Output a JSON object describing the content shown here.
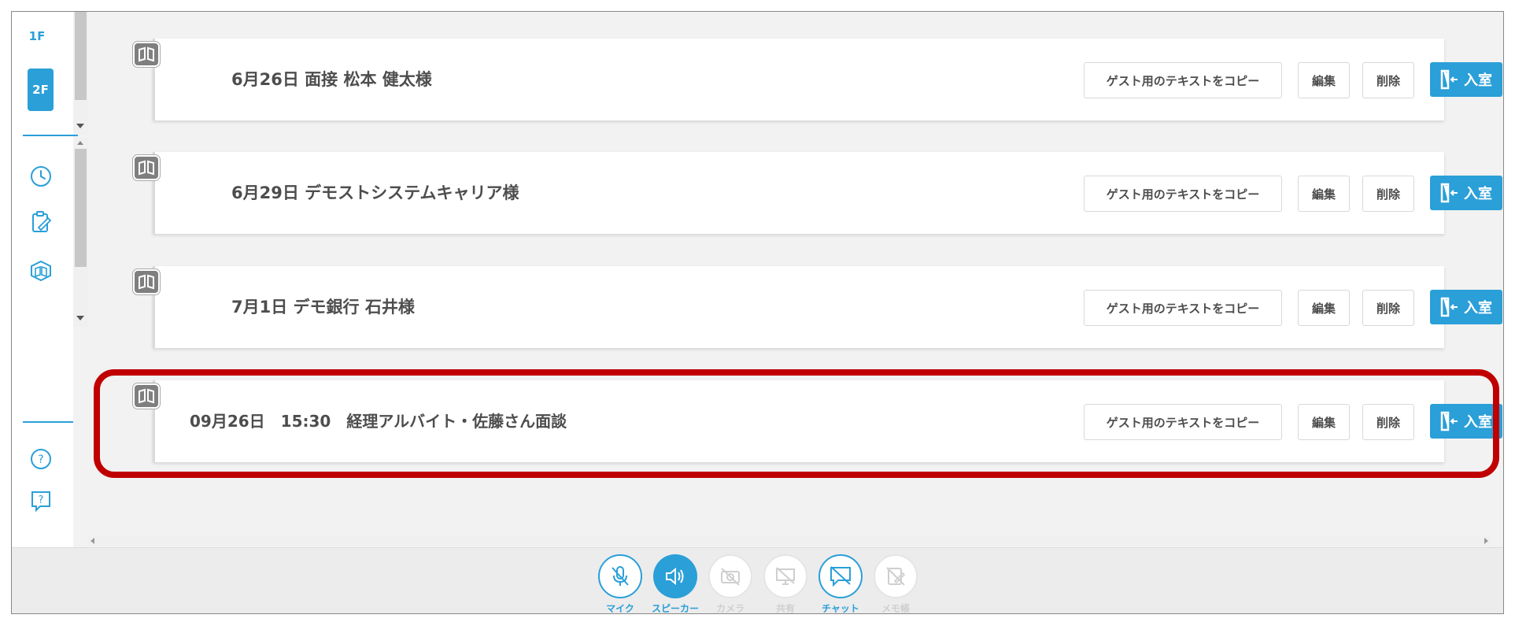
{
  "sidebar": {
    "floor_current": "1F",
    "floor_selected": "2F",
    "icons": [
      "clock-icon",
      "clipboard-edit-icon",
      "room-cube-icon",
      "help-circle-icon",
      "help-chat-icon"
    ]
  },
  "meetings": [
    {
      "title": "6月26日 面接 松本 健太様"
    },
    {
      "title": "6月29日 デモストシステムキャリア様"
    },
    {
      "title": "7月1日 デモ銀行 石井様"
    },
    {
      "title": "09月26日　15:30　経理アルバイト・佐藤さん面談"
    }
  ],
  "buttons": {
    "copy_guest_text": "ゲスト用のテキストをコピー",
    "edit": "編集",
    "delete": "削除",
    "enter": "入室"
  },
  "toolbar": {
    "mic": "マイク",
    "speaker": "スピーカー",
    "camera": "カメラ",
    "share": "共有",
    "chat": "チャット",
    "memo": "メモ帳"
  },
  "colors": {
    "accent": "#2a9fd8",
    "highlight": "#c00000",
    "disabled": "#cfcfcf"
  }
}
